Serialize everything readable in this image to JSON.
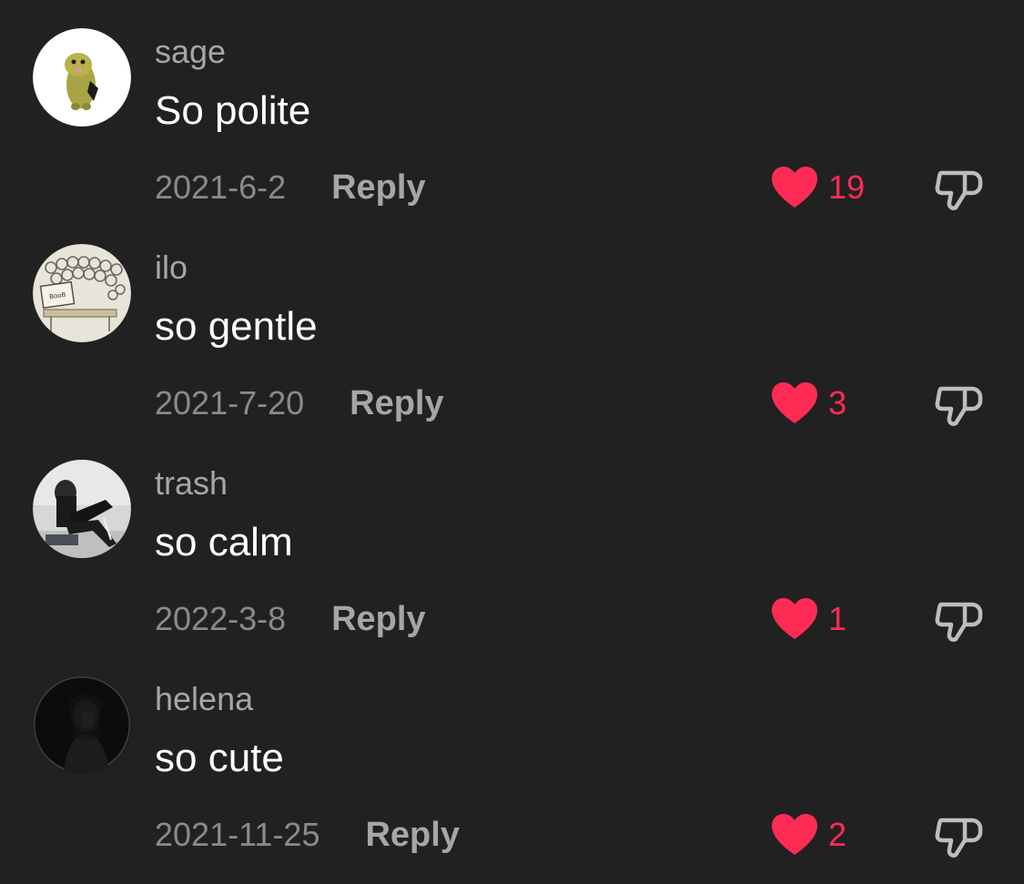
{
  "colors": {
    "background": "#212121",
    "like_accent": "#fe2c55",
    "username": "#a6a6a6",
    "comment_text": "#ffffff",
    "date": "#8a8a8a",
    "icon_outline": "#bdbdbd"
  },
  "icons": {
    "like": "heart-icon",
    "dislike": "thumbs-down-icon"
  },
  "comments": [
    {
      "username": "sage",
      "text": "So polite",
      "date": "2021-6-2",
      "reply_label": "Reply",
      "likes": "19",
      "liked": true
    },
    {
      "username": "ilo",
      "text": "so gentle",
      "date": "2021-7-20",
      "reply_label": "Reply",
      "likes": "3",
      "liked": true
    },
    {
      "username": "trash",
      "text": "so calm",
      "date": "2022-3-8",
      "reply_label": "Reply",
      "likes": "1",
      "liked": true
    },
    {
      "username": "helena",
      "text": "so cute",
      "date": "2021-11-25",
      "reply_label": "Reply",
      "likes": "2",
      "liked": true
    }
  ]
}
